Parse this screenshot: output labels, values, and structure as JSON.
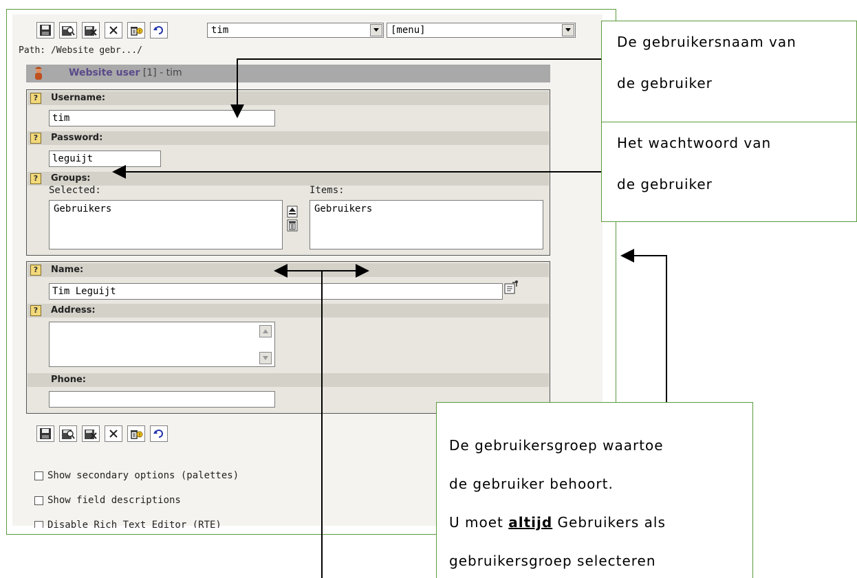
{
  "toolbar_top": {
    "buttons": [
      "save-icon",
      "save-view-icon",
      "save-close-icon",
      "close-icon",
      "delete-icon",
      "undo-icon"
    ]
  },
  "record_select": {
    "value": "tim"
  },
  "menu_select": {
    "value": "[menu]"
  },
  "path": "Path: /Website gebr.../",
  "record_header": {
    "type": "Website user",
    "id": "[1]",
    "name": "- tim"
  },
  "section1": {
    "username_label": "Username:",
    "username_value": "tim",
    "password_label": "Password:",
    "password_value": "leguijt",
    "groups_label": "Groups:",
    "selected_label": "Selected:",
    "items_label": "Items:",
    "selected_items": [
      "Gebruikers"
    ],
    "available_items": [
      "Gebruikers"
    ]
  },
  "section2": {
    "name_label": "Name:",
    "name_value": "Tim Leguijt",
    "address_label": "Address:",
    "address_value": "",
    "phone_label": "Phone:",
    "phone_value": ""
  },
  "options": [
    {
      "label": "Show secondary options (palettes)",
      "checked": false
    },
    {
      "label": "Show field descriptions",
      "checked": false
    },
    {
      "label": "Disable Rich Text Editor (RTE)",
      "checked": false
    }
  ],
  "callouts": {
    "username": [
      "De gebruikersnaam van",
      "de gebruiker"
    ],
    "password": [
      "Het wachtwoord van",
      "de gebruiker"
    ],
    "group": {
      "line1": "De gebruikersgroep waartoe",
      "line2": "de gebruiker behoort.",
      "line3_pre": "U moet",
      "line3_emph": "altijd",
      "line3_post": "Gebruikers als",
      "line4": "gebruikersgroep selecteren"
    }
  },
  "colors": {
    "frame_border": "#5a9a3a",
    "panel_bg": "#f4f3ef",
    "header_bar": "#a9a9a9",
    "label_row": "#d4d1c9"
  }
}
